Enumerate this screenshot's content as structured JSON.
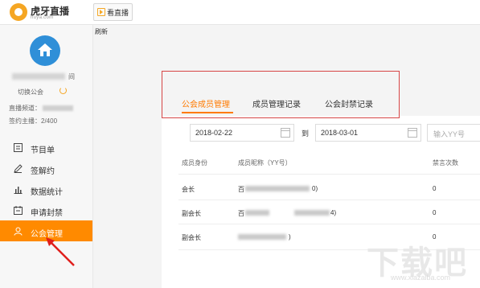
{
  "header": {
    "brand": "虎牙直播",
    "brand_sub": "huya.com",
    "watch_button": "看直播"
  },
  "sidebar": {
    "username_suffix": "间",
    "switch_guild": "切换公会",
    "channel_label": "直播频道：",
    "signed_anchors": "签约主播：2/400",
    "items": [
      {
        "label": "节目单",
        "icon": "list-icon"
      },
      {
        "label": "签解约",
        "icon": "pen-icon"
      },
      {
        "label": "数据统计",
        "icon": "bar-chart-icon"
      },
      {
        "label": "申请封禁",
        "icon": "calendar-icon"
      },
      {
        "label": "公会管理",
        "icon": "user-icon",
        "active": true
      }
    ]
  },
  "main": {
    "refresh": "刷新",
    "tabs": [
      {
        "label": "公会成员管理",
        "active": true
      },
      {
        "label": "成员管理记录"
      },
      {
        "label": "公会封禁记录"
      }
    ],
    "filters": {
      "start_date": "2018-02-22",
      "to_label": "到",
      "end_date": "2018-03-01",
      "yy_placeholder": "输入YY号"
    },
    "table": {
      "headers": [
        "成员身份",
        "成员昵称（YY号）",
        "禁言次数"
      ],
      "rows": [
        {
          "role": "会长",
          "nick_start": "百",
          "nick_end": "0)",
          "mutes": "0"
        },
        {
          "role": "副会长",
          "nick_start": "百",
          "nick_end": "4)",
          "mutes": "0"
        },
        {
          "role": "副会长",
          "nick_start": "",
          "nick_end": ")",
          "mutes": "0"
        }
      ]
    }
  },
  "watermark": {
    "text": "下载吧",
    "url": "www.xiazaiba.com"
  },
  "colors": {
    "accent": "#ff8a00",
    "highlight_border": "#d64545",
    "avatar": "#2f8fd8"
  }
}
